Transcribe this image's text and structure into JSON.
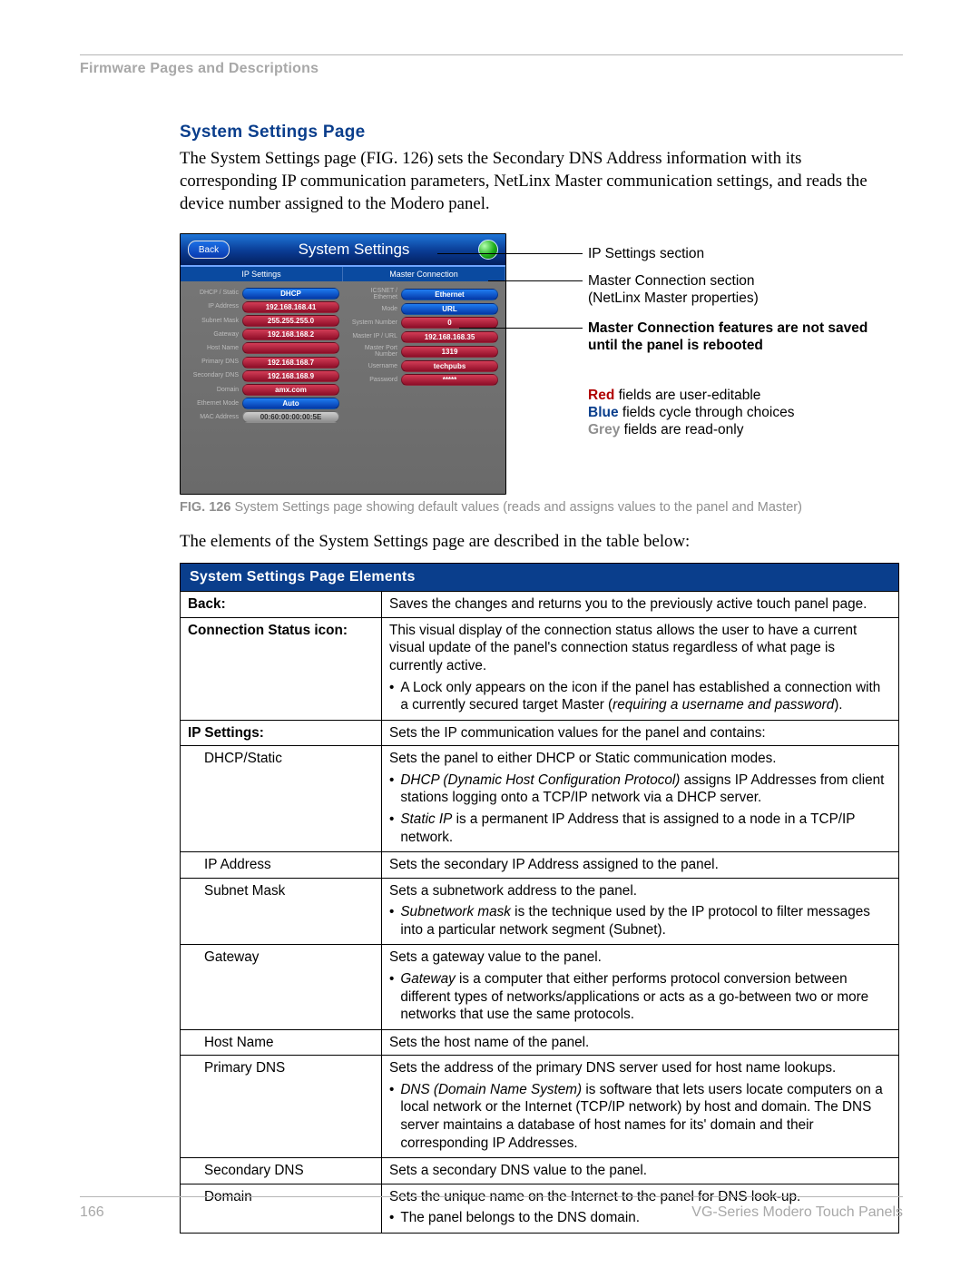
{
  "header": "Firmware Pages and Descriptions",
  "heading": "System Settings Page",
  "intro": "The System Settings page (FIG. 126) sets the Secondary DNS Address information with its corresponding IP communication parameters, NetLinx Master communication settings, and reads the device number assigned to the Modero panel.",
  "screenshot": {
    "back_label": "Back",
    "title": "System Settings",
    "section_left": "IP Settings",
    "section_right": "Master Connection",
    "left_rows": [
      {
        "label": "DHCP / Static",
        "value": "DHCP",
        "type": "blue"
      },
      {
        "label": "IP Address",
        "value": "192.168.168.41",
        "type": "red"
      },
      {
        "label": "Subnet Mask",
        "value": "255.255.255.0",
        "type": "red"
      },
      {
        "label": "Gateway",
        "value": "192.168.168.2",
        "type": "red"
      },
      {
        "label": "Host Name",
        "value": "",
        "type": "red"
      },
      {
        "label": "Primary DNS",
        "value": "192.168.168.7",
        "type": "red"
      },
      {
        "label": "Secondary DNS",
        "value": "192.168.168.9",
        "type": "red"
      },
      {
        "label": "Domain",
        "value": "amx.com",
        "type": "red"
      },
      {
        "label": "Ethernet Mode",
        "value": "Auto",
        "type": "blue"
      },
      {
        "label": "MAC Address",
        "value": "00:60:00:00:00:5E",
        "type": "grey"
      }
    ],
    "right_rows": [
      {
        "label": "ICSNET / Ethernet",
        "value": "Ethernet",
        "type": "blue"
      },
      {
        "label": "Mode",
        "value": "URL",
        "type": "blue"
      },
      {
        "label": "System Number",
        "value": "0",
        "type": "red"
      },
      {
        "label": "Master IP / URL",
        "value": "192.168.168.35",
        "type": "red"
      },
      {
        "label": "Master Port Number",
        "value": "1319",
        "type": "red"
      },
      {
        "label": "Username",
        "value": "techpubs",
        "type": "red"
      },
      {
        "label": "Password",
        "value": "*****",
        "type": "red"
      }
    ]
  },
  "callouts": {
    "c1": "IP Settings section",
    "c2a": "Master Connection section",
    "c2b": "(NetLinx Master properties)",
    "c3": "Master Connection features are not saved until the panel is rebooted",
    "c4a_b": "Red",
    "c4a": " fields are user-editable",
    "c4b_b": "Blue",
    "c4b": " fields cycle through choices",
    "c4c_b": "Grey",
    "c4c": " fields are read-only"
  },
  "figcap_b": "FIG. 126",
  "figcap": "  System Settings page showing default values (reads and assigns values to the panel and Master)",
  "para2": "The elements of the System Settings page are described in the table below:",
  "table": {
    "header": "System Settings Page Elements",
    "rows": [
      {
        "l": "Back:",
        "lb": true,
        "r": [
          [
            "t",
            "Saves the changes and returns you to the previously active touch panel page."
          ]
        ]
      },
      {
        "l": "Connection Status icon:",
        "lb": true,
        "r": [
          [
            "t",
            "This visual display of the connection status allows the user to have a current visual update of the panel's connection status regardless of what page is currently active."
          ],
          [
            "b",
            "A Lock only appears on the icon if the panel has established a connection with a currently secured target Master (<i>requiring a username and password</i>)."
          ]
        ]
      },
      {
        "l": "IP Settings:",
        "lb": true,
        "r": [
          [
            "t",
            "Sets the IP communication values for the panel and contains:"
          ]
        ]
      },
      {
        "l": "DHCP/Static",
        "sub": true,
        "r": [
          [
            "t",
            "Sets the panel to either DHCP or Static communication modes."
          ],
          [
            "b",
            "<i>DHCP (Dynamic Host Configuration Protocol)</i> assigns IP Addresses from client stations logging onto a TCP/IP network via a DHCP server."
          ],
          [
            "b",
            "<i>Static IP</i> is a permanent IP Address that is assigned to a node in a TCP/IP network."
          ]
        ]
      },
      {
        "l": "IP Address",
        "sub": true,
        "r": [
          [
            "t",
            "Sets the secondary IP Address assigned to the panel."
          ]
        ]
      },
      {
        "l": "Subnet Mask",
        "sub": true,
        "r": [
          [
            "t",
            "Sets a subnetwork address to the panel."
          ],
          [
            "b",
            "<i>Subnetwork mask</i> is the technique used by the IP protocol to filter messages into a particular network segment (Subnet)."
          ]
        ]
      },
      {
        "l": "Gateway",
        "sub": true,
        "r": [
          [
            "t",
            "Sets a gateway value to the panel."
          ],
          [
            "b",
            "<i>Gateway</i> is a computer that either performs protocol conversion between different types of networks/applications or acts as a go-between two or more networks that use the same protocols."
          ]
        ]
      },
      {
        "l": "Host Name",
        "sub": true,
        "r": [
          [
            "t",
            "Sets the host name of the panel."
          ]
        ]
      },
      {
        "l": "Primary DNS",
        "sub": true,
        "r": [
          [
            "t",
            "Sets the address of the primary DNS server used for host name lookups."
          ],
          [
            "b",
            "<i>DNS (Domain Name System)</i> is software that lets users locate computers on a local network or the Internet (TCP/IP network) by host and domain. The DNS server maintains a database of host names for its' domain and their corresponding IP Addresses."
          ]
        ]
      },
      {
        "l": "Secondary DNS",
        "sub": true,
        "r": [
          [
            "t",
            "Sets a secondary DNS value to the panel."
          ]
        ]
      },
      {
        "l": "Domain",
        "sub": true,
        "r": [
          [
            "t",
            "Sets the unique name on the Internet to the panel for DNS look-up."
          ],
          [
            "b",
            "The panel belongs to the DNS domain."
          ]
        ]
      }
    ]
  },
  "footer": {
    "page": "166",
    "doc": "VG-Series Modero Touch Panels"
  }
}
